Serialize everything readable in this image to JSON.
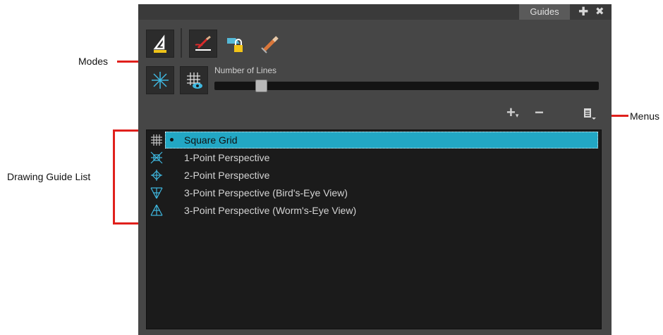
{
  "callouts": {
    "modes": "Modes",
    "menus": "Menus",
    "drawing_guide_list": "Drawing Guide List"
  },
  "panel": {
    "tab_label": "Guides",
    "number_of_lines_label": "Number of Lines",
    "number_of_lines_value": 0.11
  },
  "guides": [
    {
      "label": "Square Grid",
      "icon": "grid-icon",
      "selected": true
    },
    {
      "label": "1-Point Perspective",
      "icon": "one-point-perspective-icon",
      "selected": false
    },
    {
      "label": "2-Point Perspective",
      "icon": "two-point-perspective-icon",
      "selected": false
    },
    {
      "label": "3-Point Perspective (Bird's-Eye View)",
      "icon": "three-point-birds-eye-icon",
      "selected": false
    },
    {
      "label": "3-Point Perspective (Worm's-Eye View)",
      "icon": "three-point-worms-eye-icon",
      "selected": false
    }
  ],
  "colors": {
    "selection": "#22a7c4",
    "callout_line": "#e0201c"
  }
}
